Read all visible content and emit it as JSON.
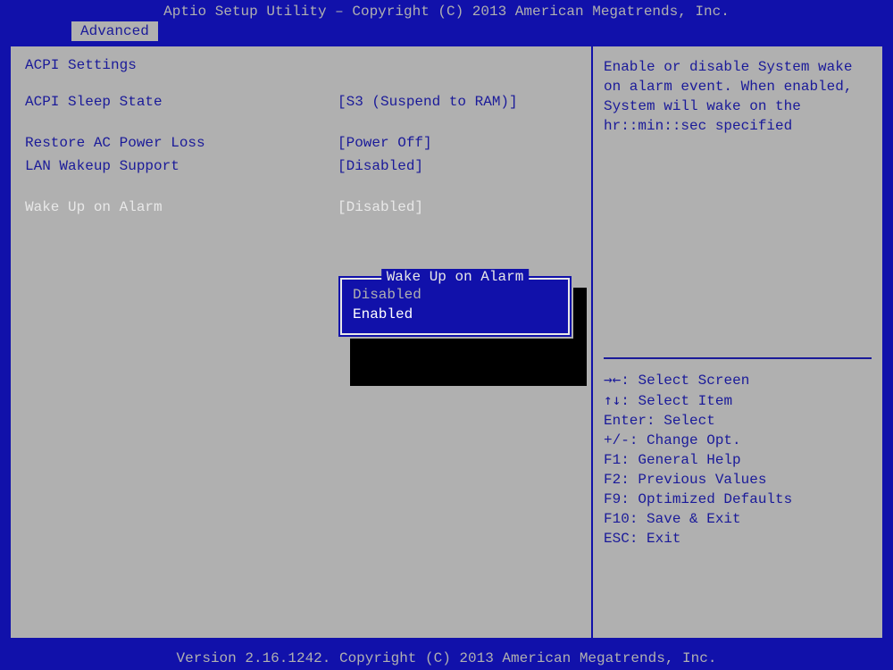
{
  "header": {
    "title": "Aptio Setup Utility – Copyright (C) 2013 American Megatrends, Inc."
  },
  "tabs": {
    "active": "Advanced"
  },
  "section": {
    "title": "ACPI Settings"
  },
  "settings": [
    {
      "label": "ACPI Sleep State",
      "value": "[S3 (Suspend to RAM)]"
    },
    {
      "label": "Restore AC Power Loss",
      "value": "[Power Off]"
    },
    {
      "label": "LAN Wakeup Support",
      "value": "[Disabled]"
    },
    {
      "label": "Wake Up on Alarm",
      "value": "[Disabled]"
    }
  ],
  "popup": {
    "title": "Wake Up on Alarm",
    "options": [
      "Disabled",
      "Enabled"
    ],
    "selected": "Enabled"
  },
  "help": {
    "text": "Enable or disable System wake on alarm event. When enabled, System will wake on the hr::min::sec specified"
  },
  "keys": [
    {
      "key": "→←",
      "desc": ": Select Screen"
    },
    {
      "key": "↑↓",
      "desc": ": Select Item"
    },
    {
      "key": "Enter",
      "desc": ": Select"
    },
    {
      "key": "+/-",
      "desc": ": Change Opt."
    },
    {
      "key": "F1",
      "desc": ": General Help"
    },
    {
      "key": "F2",
      "desc": ": Previous Values"
    },
    {
      "key": "F9",
      "desc": ": Optimized Defaults"
    },
    {
      "key": "F10",
      "desc": ": Save & Exit"
    },
    {
      "key": "ESC",
      "desc": ": Exit"
    }
  ],
  "footer": {
    "text": "Version 2.16.1242. Copyright (C) 2013 American Megatrends, Inc."
  }
}
